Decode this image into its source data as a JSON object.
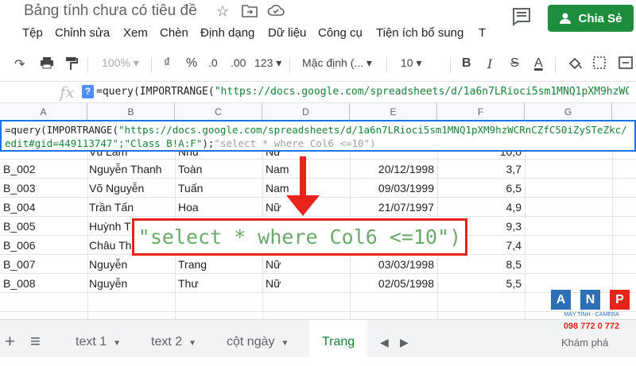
{
  "window": {
    "title": "Bảng tính chưa có tiêu đề"
  },
  "header": {
    "share_label": "Chia Sẻ"
  },
  "menu": [
    "Tệp",
    "Chỉnh sửa",
    "Xem",
    "Chèn",
    "Định dạng",
    "Dữ liệu",
    "Công cụ",
    "Tiện ích bổ sung",
    "T"
  ],
  "toolbar": {
    "zoom": "100%",
    "currency": "₫",
    "percent": "%",
    "dec_decrease": ".0",
    "dec_increase": ".00",
    "more_formats": "123",
    "font": "Mặc định (...",
    "font_size": "10",
    "bold": "B",
    "italic": "I",
    "strike": "S",
    "text_color": "A"
  },
  "formula_bar": {
    "fx": "fx",
    "help": "?",
    "func": "=query(IMPORTRANGE(",
    "arg": "\"https://docs.google.com/spreadsheets/d/1a6n7LRioci5sm1MNQ1pXM9hzWCR"
  },
  "columns": [
    "A",
    "B",
    "C",
    "D",
    "E",
    "F",
    "G"
  ],
  "rows": [
    [
      "",
      "Vũ Lâm",
      "Nhu",
      "Nữ",
      "",
      "10,0"
    ],
    [
      "B_002",
      "Nguyễn Thanh",
      "Toàn",
      "Nam",
      "20/12/1998",
      "3,7"
    ],
    [
      "B_003",
      "Võ Nguyễn",
      "Tuấn",
      "Nam",
      "09/03/1999",
      "6,5"
    ],
    [
      "B_004",
      "Trần Tấn",
      "Hoa",
      "Nữ",
      "21/07/1997",
      "4,9"
    ],
    [
      "B_005",
      "Huỳnh T",
      "",
      "N",
      "",
      "9,3"
    ],
    [
      "B_006",
      "Châu Th",
      "",
      "",
      "",
      "7,4"
    ],
    [
      "B_007",
      "Nguyễn",
      "Trang",
      "Nữ",
      "03/03/1998",
      "8,5"
    ],
    [
      "B_008",
      "Nguyễn",
      "Thư",
      "Nữ",
      "02/05/1998",
      "5,5"
    ]
  ],
  "popup": {
    "line1_func": "=query(IMPORTRANGE(",
    "line1_str": "\"https://docs.google.com/spreadsheets/d/1a6n7LRioci5sm1MNQ1pXM9hzWCRnCZfC50iZySTeZkc/",
    "line2_str": "edit#gid=449113747\";\"Class B!A:F\"",
    "line2_mid": ");",
    "line2_hint": "\"select * where Col6 <=10\")"
  },
  "callout": {
    "text": "\"select * where Col6 <=10\")"
  },
  "tabs": {
    "add": "+",
    "list": "≡",
    "items": [
      "text 1",
      "text 2",
      "cột ngày"
    ],
    "active": "Trang"
  },
  "watermark": {
    "letters": [
      "A",
      "N",
      "P"
    ],
    "line1": "MÁY TÍNH - CAMERA",
    "line2": "098 772 0 772",
    "explore": "Khám phá"
  },
  "colors": {
    "accent": "#1a73e8",
    "share": "#1e8e3e",
    "annotation": "#e8231b",
    "string": "#188038"
  }
}
